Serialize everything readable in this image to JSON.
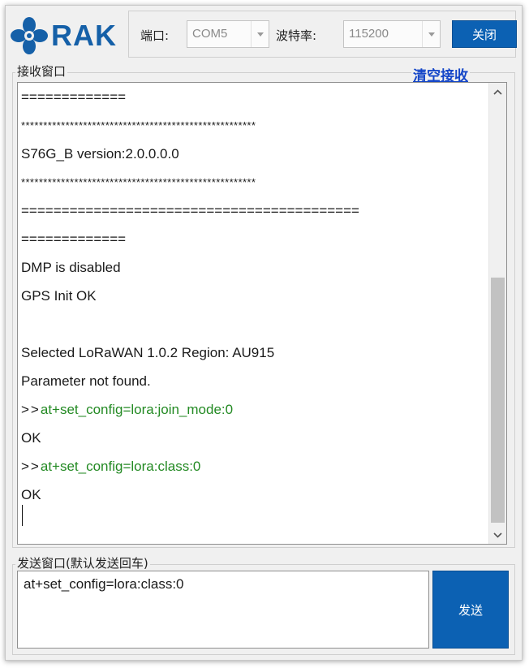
{
  "app": {
    "logo_text": "RAK"
  },
  "serial": {
    "port_label": "端口:",
    "port_value": "COM5",
    "baud_label": "波特率:",
    "baud_value": "115200",
    "close_label": "关闭"
  },
  "receive": {
    "group_label": "接收窗口",
    "clear_label": "清空接收",
    "lines": [
      {
        "text": "=============",
        "kind": "plain"
      },
      {
        "text": "*****************************************************",
        "kind": "stars"
      },
      {
        "text": "S76G_B version:2.0.0.0.0",
        "kind": "plain"
      },
      {
        "text": "*****************************************************",
        "kind": "stars"
      },
      {
        "text": "==========================================",
        "kind": "plain"
      },
      {
        "text": "=============",
        "kind": "plain"
      },
      {
        "text": "DMP is disabled",
        "kind": "plain"
      },
      {
        "text": "GPS Init OK",
        "kind": "plain"
      },
      {
        "text": "",
        "kind": "plain"
      },
      {
        "text": "Selected LoRaWAN 1.0.2 Region: AU915",
        "kind": "plain"
      },
      {
        "text": "Parameter not found.",
        "kind": "plain"
      },
      {
        "prompt": ">>",
        "text": "at+set_config=lora:join_mode:0",
        "kind": "cmd"
      },
      {
        "text": "OK",
        "kind": "plain"
      },
      {
        "prompt": ">>",
        "text": "at+set_config=lora:class:0",
        "kind": "cmd"
      },
      {
        "text": "OK",
        "kind": "plain"
      }
    ]
  },
  "send": {
    "group_label": "发送窗口(默认发送回车)",
    "input_value": "at+set_config=lora:class:0",
    "send_label": "发送"
  },
  "colors": {
    "brand": "#1560a8",
    "button": "#0c61b3",
    "link": "#1446c8",
    "command_echo": "#238a23"
  },
  "icons": {
    "logo": "rak-logo-icon",
    "combo_arrow": "chevron-down-icon",
    "scroll_up": "chevron-up-icon",
    "scroll_down": "chevron-down-icon"
  }
}
